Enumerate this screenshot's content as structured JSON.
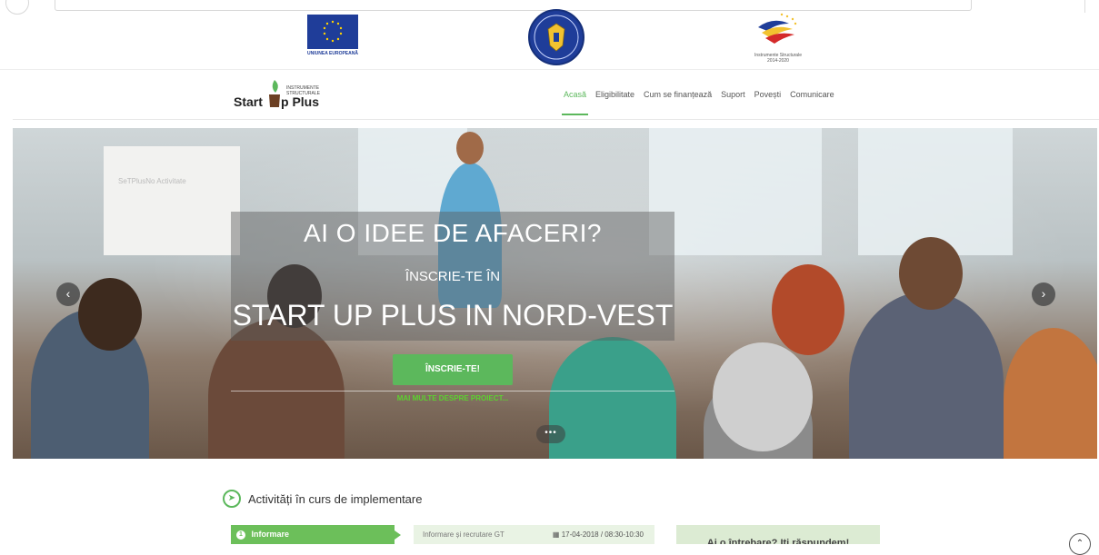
{
  "logos": {
    "eu_label": "UNIUNEA EUROPEANĂ",
    "gov_seal_text": "GUVERNUL ROMÂNIEI",
    "structural_label_line1": "Instrumente Structurale",
    "structural_label_line2": "2014-2020"
  },
  "brand": {
    "word_a": "Start",
    "word_b": "p Plus",
    "small_text": "INSTRUMENTE STRUCTURALE"
  },
  "menu": [
    {
      "label": "Acasă",
      "active": true
    },
    {
      "label": "Eligibilitate",
      "active": false
    },
    {
      "label": "Cum se finanțează",
      "active": false
    },
    {
      "label": "Suport",
      "active": false
    },
    {
      "label": "Povești",
      "active": false
    },
    {
      "label": "Comunicare",
      "active": false
    }
  ],
  "hero": {
    "title": "AI O IDEE DE AFACERI?",
    "subtitle": "ÎNSCRIE-TE ÎN",
    "program": "START UP PLUS IN NORD-VEST",
    "cta_label": "ÎNSCRIE-TE!",
    "more_link": "MAI MULTE DESPRE PROIECT...",
    "prev_icon": "chevron-left-icon",
    "next_icon": "chevron-right-icon",
    "dots": "•••",
    "screen_text": "SeTPlusNo Activitate"
  },
  "activities": {
    "title": "Activități în curs de implementare",
    "step_number": "1",
    "step_label": "Informare",
    "event_name": "Informare și recrutare GT",
    "event_date": "17-04-2018 / 08:30-10:30",
    "faq_text": "Ai o întrebare? Iți răspundem!"
  },
  "colors": {
    "accent": "#5cb85c",
    "eu_blue": "#1f3d99"
  }
}
